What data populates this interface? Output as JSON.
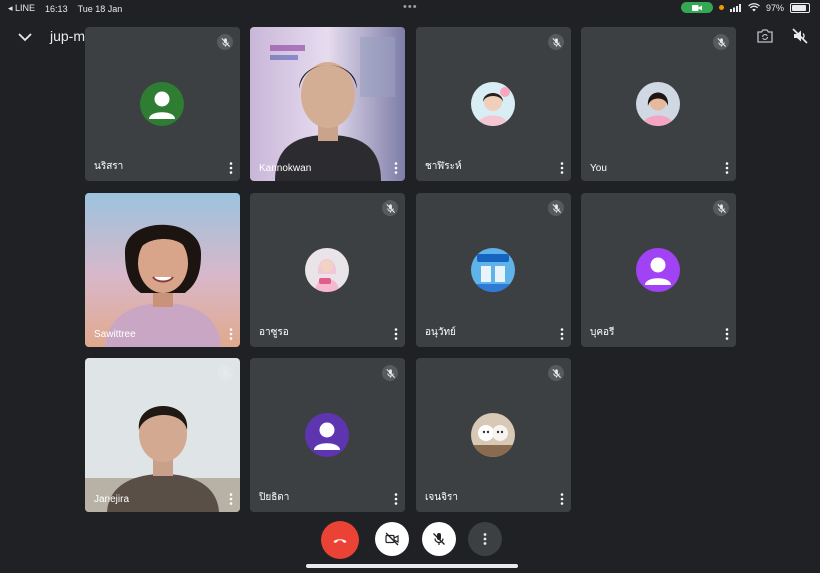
{
  "status_bar": {
    "back_app": "LINE",
    "time": "16:13",
    "date": "Tue 18 Jan",
    "battery": "97%"
  },
  "header": {
    "meeting_code": "jup-mzku-was"
  },
  "participants": [
    {
      "name": "นริสรา",
      "muted": true,
      "display": "avatar",
      "avatar_color": "#2e7d32"
    },
    {
      "name": "Kannokwan",
      "muted": false,
      "display": "video"
    },
    {
      "name": "ชาฬิระห์",
      "muted": true,
      "display": "photo"
    },
    {
      "name": "You",
      "muted": true,
      "display": "photo"
    },
    {
      "name": "Sawittree",
      "muted": false,
      "display": "video"
    },
    {
      "name": "อาซูรอ",
      "muted": true,
      "display": "photo"
    },
    {
      "name": "อนุวัทย์",
      "muted": true,
      "display": "photo"
    },
    {
      "name": "บุคอรี",
      "muted": true,
      "display": "avatar",
      "avatar_color": "#a142f4"
    },
    {
      "name": "Janejira",
      "muted": true,
      "display": "video"
    },
    {
      "name": "ปิยธิดา",
      "muted": true,
      "display": "avatar",
      "avatar_color": "#5e35b1"
    },
    {
      "name": "เจนจิรา",
      "muted": true,
      "display": "photo"
    }
  ],
  "controls": {
    "end_call_color": "#ea4335",
    "camera_state": "off",
    "mic_state": "off"
  },
  "colors": {
    "background": "#202124",
    "tile": "#3c4043"
  }
}
